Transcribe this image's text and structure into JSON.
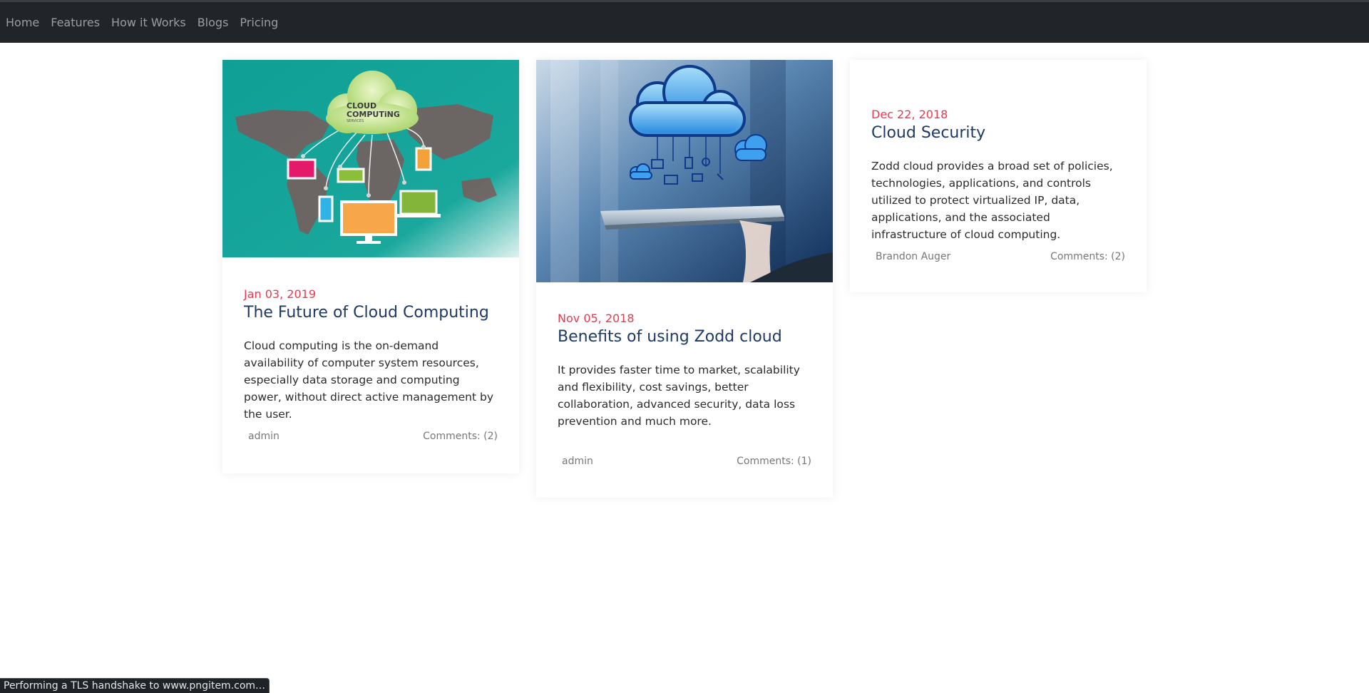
{
  "nav": {
    "items": [
      "Home",
      "Features",
      "How it Works",
      "Blogs",
      "Pricing"
    ]
  },
  "posts": [
    {
      "image": "cloud-computing-services-illustration",
      "date": "Jan 03, 2019",
      "title": "The Future of Cloud Computing",
      "description": "Cloud computing is the on-demand availability of computer system resources, especially data storage and computing power, without direct active management by the user.",
      "author": "admin",
      "comments": "Comments: (2)"
    },
    {
      "image": "cloud-tablet-photo",
      "date": "Nov 05, 2018",
      "title": "Benefits of using Zodd cloud",
      "description": "It provides faster time to market, scalability and flexibility, cost savings, better collaboration, advanced security, data loss prevention and much more.",
      "author": "admin",
      "comments": "Comments: (1)"
    },
    {
      "date": "Dec 22, 2018",
      "title": "Cloud Security",
      "description": "Zodd cloud provides a broad set of policies, technologies, applications, and controls utilized to protect virtualized IP, data, applications, and the associated infrastructure of cloud computing.",
      "author": "Brandon Auger",
      "comments": "Comments: (2)"
    }
  ],
  "image1_text": {
    "line1": "CLOUD",
    "line2": "COMPUTiNG",
    "line3": "SERVICES"
  },
  "status": "Performing a TLS handshake to www.pngitem.com…",
  "colors": {
    "navbar": "#212529",
    "date": "#e8394f",
    "title": "#1e3963",
    "teal": "#19a79c"
  }
}
